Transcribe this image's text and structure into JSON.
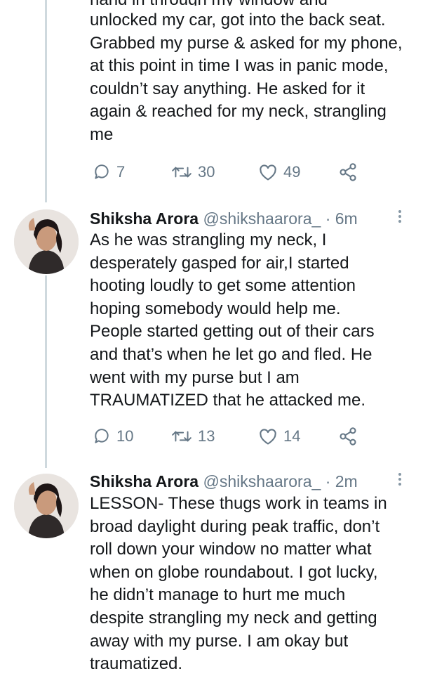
{
  "colors": {
    "text": "#14171a",
    "muted": "#657786",
    "line": "#cfd9de",
    "icon": "#657786"
  },
  "tweet0": {
    "cut_text": "hand in through my window and",
    "lines": [
      "unlocked my car, got into the back seat.",
      "Grabbed my purse & asked for my phone,",
      "at this point in time I was in panic mode,",
      "couldn’t say anything. He asked for it",
      "again & reached for my neck, strangling",
      "me"
    ],
    "replies": "7",
    "retweets": "30",
    "likes": "49"
  },
  "tweet1": {
    "name": "Shiksha Arora",
    "handle": "@shikshaarora_",
    "time": "· 6m",
    "lines": [
      "As he was strangling my neck, I",
      "desperately gasped for air,I started",
      "hooting loudly to get some attention",
      "hoping somebody would help me.",
      "People started getting out of their cars",
      "and that’s when he let go and fled. He",
      "went with my purse but I am",
      "TRAUMATIZED that he attacked me."
    ],
    "replies": "10",
    "retweets": "13",
    "likes": "14"
  },
  "tweet2": {
    "name": "Shiksha Arora",
    "handle": "@shikshaarora_",
    "time": "· 2m",
    "lines": [
      "LESSON- These thugs work in teams in",
      "broad daylight during peak traffic, don’t",
      "roll down your window no matter what",
      "when on globe roundabout. I got lucky,",
      "he didn’t manage to hurt me much",
      "despite strangling my neck and getting",
      "away with my purse. I am okay but",
      "traumatized."
    ]
  }
}
